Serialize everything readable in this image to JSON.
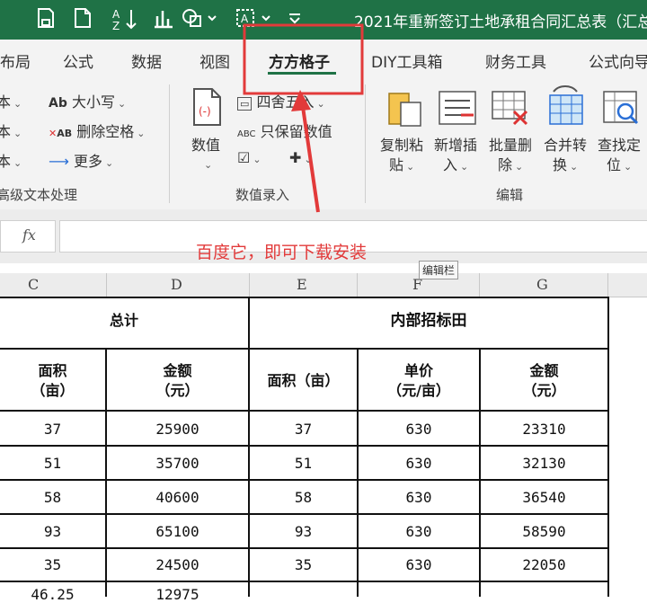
{
  "window": {
    "title": "2021年重新签订土地承租合同汇总表（汇总"
  },
  "quick_access": {
    "icons": [
      "save-icon",
      "new-file-icon",
      "sort-az-icon",
      "chart-icon",
      "shapes-icon",
      "text-box-icon",
      "customize-icon"
    ]
  },
  "tabs": [
    {
      "label": "布局"
    },
    {
      "label": "公式"
    },
    {
      "label": "数据"
    },
    {
      "label": "视图"
    },
    {
      "label": "方方格子",
      "active": true
    },
    {
      "label": "DIY工具箱"
    },
    {
      "label": "财务工具"
    },
    {
      "label": "公式向导"
    }
  ],
  "ribbon": {
    "left_partial": [
      "本",
      "本",
      "本"
    ],
    "text_group": {
      "case_label": "大小写",
      "delete_space_label": "删除空格",
      "more_label": "更多",
      "group_name": "高级文本处理"
    },
    "value_group": {
      "value_button": "数值",
      "round_label": "四舍五入",
      "keep_value_label": "只保留数值",
      "group_name": "数值录入"
    },
    "edit_group": {
      "buttons": [
        {
          "line1": "复制粘",
          "line2": "贴"
        },
        {
          "line1": "新增插",
          "line2": "入"
        },
        {
          "line1": "批量删",
          "line2": "除"
        },
        {
          "line1": "合并转",
          "line2": "换"
        },
        {
          "line1": "查找定",
          "line2": "位"
        }
      ],
      "group_name": "编辑"
    }
  },
  "formula_bar": {
    "fx_label": "fx",
    "tooltip": "编辑栏"
  },
  "annotation": {
    "text": "百度它，即可下载安装",
    "color": "#e23a3a"
  },
  "columns": [
    "C",
    "D",
    "E",
    "F",
    "G"
  ],
  "table": {
    "group_headers": {
      "total": "总计",
      "internal": "内部招标田"
    },
    "sub_headers": {
      "area_line1": "面积",
      "area_line2": "（亩）",
      "amount_line1": "金额",
      "amount_line2": "（元）",
      "area_inline": "面积（亩）",
      "price_line1": "单价",
      "price_line2": "（元/亩）",
      "amount2_line1": "金额",
      "amount2_line2": "（元）"
    },
    "rows": [
      [
        "37",
        "25900",
        "37",
        "630",
        "23310"
      ],
      [
        "51",
        "35700",
        "51",
        "630",
        "32130"
      ],
      [
        "58",
        "40600",
        "58",
        "630",
        "36540"
      ],
      [
        "93",
        "65100",
        "93",
        "630",
        "58590"
      ],
      [
        "35",
        "24500",
        "35",
        "630",
        "22050"
      ],
      [
        "46.25",
        "12975",
        "",
        "",
        ""
      ]
    ]
  },
  "colors": {
    "excel_green": "#1f7246",
    "highlight_red": "#e23a3a"
  }
}
